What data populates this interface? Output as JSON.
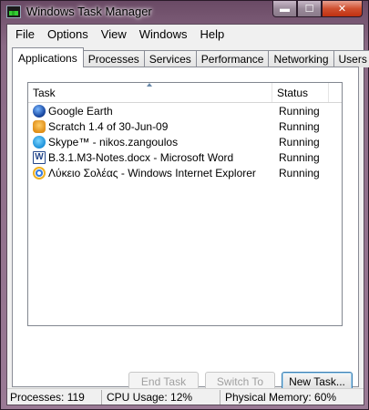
{
  "window": {
    "title": "Windows Task Manager"
  },
  "title_controls": {
    "minimize": "▬",
    "maximize": "☐",
    "close": "✕"
  },
  "menu": [
    "File",
    "Options",
    "View",
    "Windows",
    "Help"
  ],
  "tabs": [
    {
      "label": "Applications",
      "active": true
    },
    {
      "label": "Processes"
    },
    {
      "label": "Services"
    },
    {
      "label": "Performance"
    },
    {
      "label": "Networking"
    },
    {
      "label": "Users"
    }
  ],
  "list": {
    "columns": {
      "task": "Task",
      "status": "Status"
    },
    "rows": [
      {
        "icon": "google-earth-icon",
        "task": "Google Earth",
        "status": "Running"
      },
      {
        "icon": "scratch-icon",
        "task": "Scratch 1.4 of 30-Jun-09",
        "status": "Running"
      },
      {
        "icon": "skype-icon",
        "task": "Skype™ - nikos.zangoulos",
        "status": "Running"
      },
      {
        "icon": "word-icon",
        "task": "B.3.1.M3-Notes.docx - Microsoft Word",
        "status": "Running"
      },
      {
        "icon": "internet-explorer-icon",
        "task": "Λύκειο Σολέας - Windows Internet Explorer",
        "status": "Running"
      }
    ]
  },
  "buttons": {
    "end_task": "End Task",
    "switch_to": "Switch To",
    "new_task": "New Task..."
  },
  "statusbar": {
    "processes": "Processes: 119",
    "cpu": "CPU Usage: 12%",
    "memory": "Physical Memory: 60%"
  }
}
